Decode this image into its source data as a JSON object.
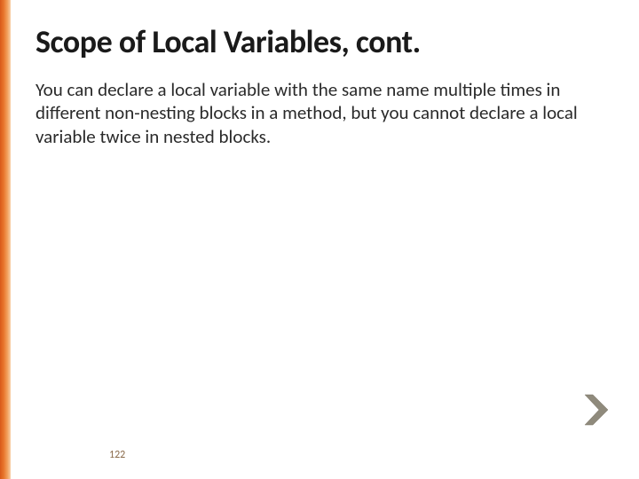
{
  "slide": {
    "title": "Scope of Local Variables, cont.",
    "body": "You can declare a local variable with the same name multiple times in different non-nesting blocks in a method, but you cannot declare a local variable twice in nested blocks.",
    "page_number": "122"
  },
  "colors": {
    "accent": "#e8762c",
    "chevron": "#8a8578"
  }
}
